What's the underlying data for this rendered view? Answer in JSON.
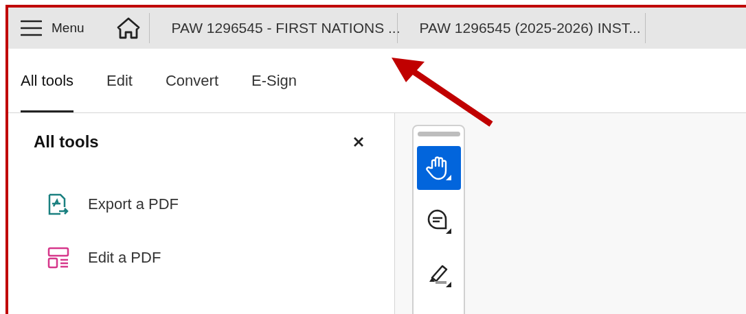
{
  "menu": {
    "label": "Menu"
  },
  "documents": [
    {
      "title": "PAW 1296545 - FIRST NATIONS ..."
    },
    {
      "title": "PAW 1296545 (2025-2026) INST..."
    }
  ],
  "tabs": [
    {
      "label": "All tools",
      "selected": true
    },
    {
      "label": "Edit",
      "selected": false
    },
    {
      "label": "Convert",
      "selected": false
    },
    {
      "label": "E-Sign",
      "selected": false
    }
  ],
  "panel": {
    "title": "All tools",
    "items": [
      {
        "label": "Export a PDF",
        "kind": "export"
      },
      {
        "label": "Edit a PDF",
        "kind": "edit"
      }
    ]
  },
  "toolbar": [
    {
      "kind": "hand",
      "selected": true
    },
    {
      "kind": "comment",
      "selected": false
    },
    {
      "kind": "highlight",
      "selected": false
    }
  ]
}
